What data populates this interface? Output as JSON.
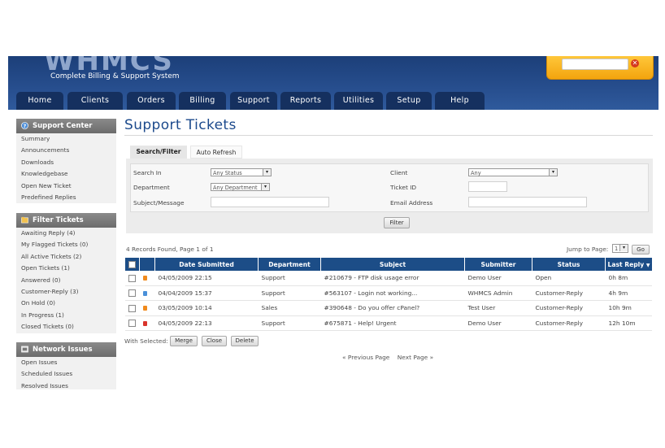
{
  "header": {
    "logo": "WHMCS",
    "tagline": "Complete Billing & Support System"
  },
  "nav": {
    "tabs": [
      "Home",
      "Clients",
      "Orders",
      "Billing",
      "Support",
      "Reports",
      "Utilities",
      "Setup",
      "Help"
    ]
  },
  "sidebar": {
    "support_center": {
      "title": "Support Center",
      "items": [
        "Summary",
        "Announcements",
        "Downloads",
        "Knowledgebase",
        "Open New Ticket",
        "Predefined Replies"
      ]
    },
    "filter_tickets": {
      "title": "Filter Tickets",
      "items": [
        "Awaiting Reply (4)",
        "My Flagged Tickets (0)",
        "All Active Tickets (2)",
        "Open Tickets (1)",
        "Answered (0)",
        "Customer-Reply (3)",
        "On Hold (0)",
        "In Progress (1)",
        "Closed Tickets (0)"
      ]
    },
    "network_issues": {
      "title": "Network Issues",
      "items": [
        "Open Issues",
        "Scheduled Issues",
        "Resolved Issues"
      ]
    }
  },
  "main": {
    "title": "Support Tickets",
    "tabs": {
      "search": "Search/Filter",
      "auto": "Auto Refresh"
    },
    "filter": {
      "search_in_label": "Search In",
      "search_in_value": "Any Status",
      "department_label": "Department",
      "department_value": "Any Department",
      "subject_label": "Subject/Message",
      "client_label": "Client",
      "client_value": "Any",
      "ticket_id_label": "Ticket ID",
      "email_label": "Email Address",
      "filter_button": "Filter"
    },
    "records_text": "4 Records Found, Page 1 of 1",
    "jump_label": "Jump to Page:",
    "jump_value": "1",
    "go_button": "Go",
    "table": {
      "headers": [
        "Date Submitted",
        "Department",
        "Subject",
        "Submitter",
        "Status",
        "Last Reply"
      ],
      "sort_indicator": "▼",
      "rows": [
        {
          "date": "04/05/2009 22:15",
          "department": "Support",
          "subject": "#210679 - FTP disk usage error",
          "submitter": "Demo User",
          "status": "Open",
          "last_reply": "0h 8m",
          "flag": "#f08a1c",
          "status_class": "status-open"
        },
        {
          "date": "04/04/2009 15:37",
          "department": "Support",
          "subject": "#563107 - Login not working...",
          "submitter": "WHMCS Admin",
          "status": "Customer-Reply",
          "last_reply": "4h 9m",
          "flag": "#4a90d9",
          "status_class": "status-reply"
        },
        {
          "date": "03/05/2009 10:14",
          "department": "Sales",
          "subject": "#390648 - Do you offer cPanel?",
          "submitter": "Test User",
          "status": "Customer-Reply",
          "last_reply": "10h 9m",
          "flag": "#f08a1c",
          "status_class": "status-reply"
        },
        {
          "date": "04/05/2009 22:13",
          "department": "Support",
          "subject": "#675871 - Help! Urgent",
          "submitter": "Demo User",
          "status": "Customer-Reply",
          "last_reply": "12h 10m",
          "flag": "#d9342b",
          "status_class": "status-reply"
        }
      ]
    },
    "with_selected_label": "With Selected:",
    "actions": [
      "Merge",
      "Close",
      "Delete"
    ],
    "pager": {
      "prev": "« Previous Page",
      "next": "Next Page »"
    }
  },
  "colors": {
    "header": "#274e8e",
    "nav_tab": "#15305f",
    "table_head": "#1c4d87",
    "accent_orange": "#f3a40e"
  }
}
